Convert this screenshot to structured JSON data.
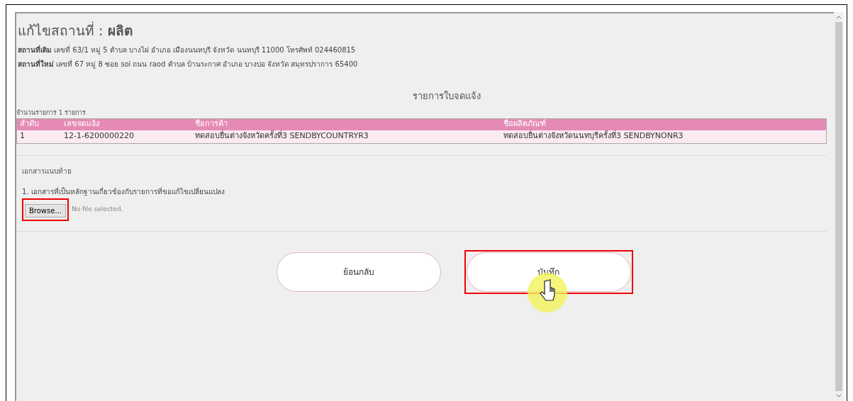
{
  "title": {
    "prefix": "แก้ไขสถานที่ :",
    "name": "ผลิต"
  },
  "addresses": [
    {
      "label": "สถานที่เดิม",
      "text": "เลขที่ 63/1 หมู่ 5 ตำบล บางไผ่ อำเภอ เมืองนนทบุรี จังหวัด นนทบุรี 11000 โทรศัพท์ 024460815"
    },
    {
      "label": "สถานที่ใหม่",
      "text": "เลขที่ 67 หมู่ 8 ซอย soi ถนน raod ตำบล บ้านระกาศ อำเภอ บางบ่อ จังหวัด สมุทรปราการ 65400"
    }
  ],
  "table": {
    "title": "รายการใบจดแจ้ง",
    "count": "จำนวนรายการ 1 รายการ",
    "columns": [
      "ลำดับ",
      "เลขจดแจ้ง",
      "ชื่อการค้า",
      "ชื่อผลิตภัณฑ์"
    ],
    "rows": [
      [
        "1",
        "12-1-6200000220",
        "ทดสอบยื่นต่างจังหวัดครั้งที่3 SENDBYCOUNTRYR3",
        "ทดสอบยื่นต่างจังหวัดนนทบุรีครั้งที่3 SENDBYNONR3"
      ]
    ]
  },
  "attachments": {
    "heading": "เอกสารแนบท้าย",
    "item": "1. เอกสารที่เป็นหลักฐานเกี่ยวข้องกับรายการที่ขอแก้ไขเปลี่ยนแปลง",
    "browse": {
      "label": "Browse...",
      "highlighted": true
    },
    "file_status": "No file selected."
  },
  "buttons": [
    {
      "label": "ย้อนกลับ",
      "highlighted": false,
      "cursor": false
    },
    {
      "label": "บันทึก",
      "highlighted": true,
      "cursor": true
    }
  ]
}
